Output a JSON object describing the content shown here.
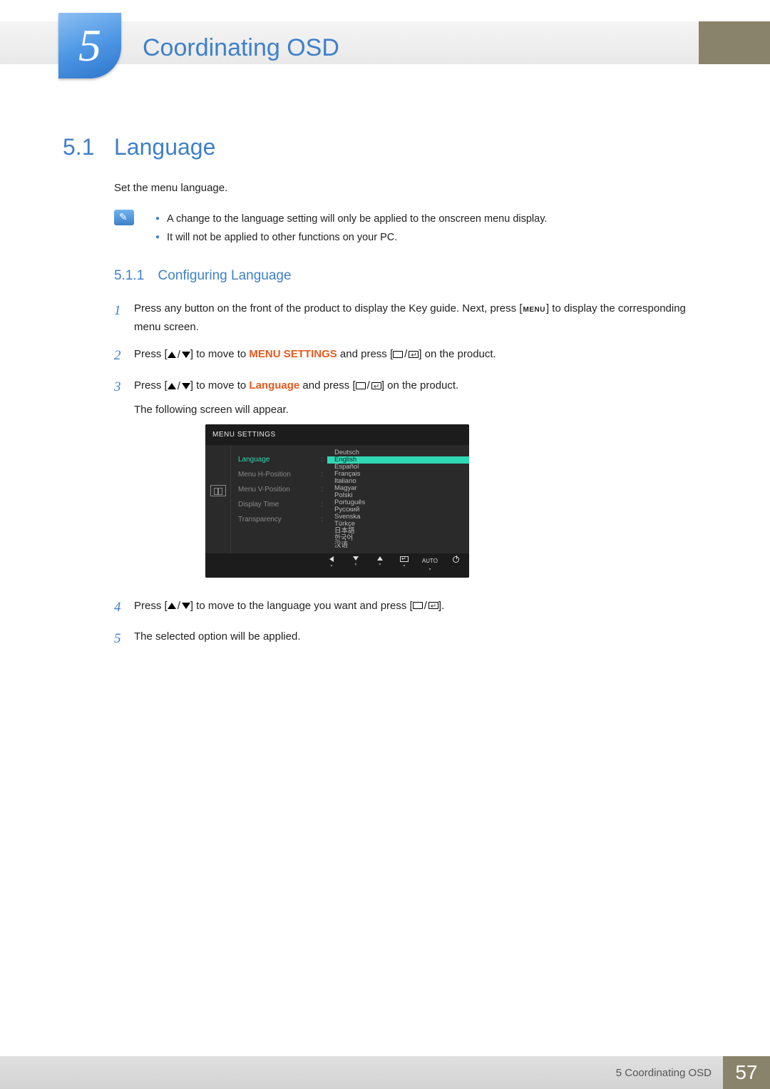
{
  "chapter": {
    "number": "5",
    "title": "Coordinating OSD"
  },
  "section": {
    "number": "5.1",
    "title": "Language",
    "intro": "Set the menu language."
  },
  "notes": [
    "A change to the language setting will only be applied to the onscreen menu display.",
    "It will not be applied to other functions on your PC."
  ],
  "subsection": {
    "number": "5.1.1",
    "title": "Configuring Language"
  },
  "steps": {
    "s1a": "Press any button on the front of the product to display the Key guide. Next, press [",
    "s1_menu": "MENU",
    "s1b": "] to display the corresponding menu screen.",
    "s2a": "Press [",
    "s2b": "] to move to ",
    "s2_menu_settings": "MENU SETTINGS",
    "s2c": " and press [",
    "s2d": "] on the product.",
    "s3a": "Press [",
    "s3b": "] to move to ",
    "s3_lang": "Language",
    "s3c": " and press [",
    "s3d": "] on the product.",
    "s3e": "The following screen will appear.",
    "s4a": "Press [",
    "s4b": "] to move to the language you want and press [",
    "s4c": "].",
    "s5": "The selected option will be applied."
  },
  "osd": {
    "header": "MENU SETTINGS",
    "left_items": [
      {
        "label": "Language",
        "active": true
      },
      {
        "label": "Menu H-Position",
        "active": false
      },
      {
        "label": "Menu V-Position",
        "active": false
      },
      {
        "label": "Display Time",
        "active": false
      },
      {
        "label": "Transparency",
        "active": false
      }
    ],
    "languages": [
      "Deutsch",
      "English",
      "Español",
      "Français",
      "Italiano",
      "Magyar",
      "Polski",
      "Português",
      "Русский",
      "Svenska",
      "Türkçe",
      "日本語",
      "한국어",
      "汉语"
    ],
    "selected_language_index": 1,
    "footer_auto": "AUTO"
  },
  "footer": {
    "chapter_ref": "5 Coordinating OSD",
    "page": "57"
  }
}
